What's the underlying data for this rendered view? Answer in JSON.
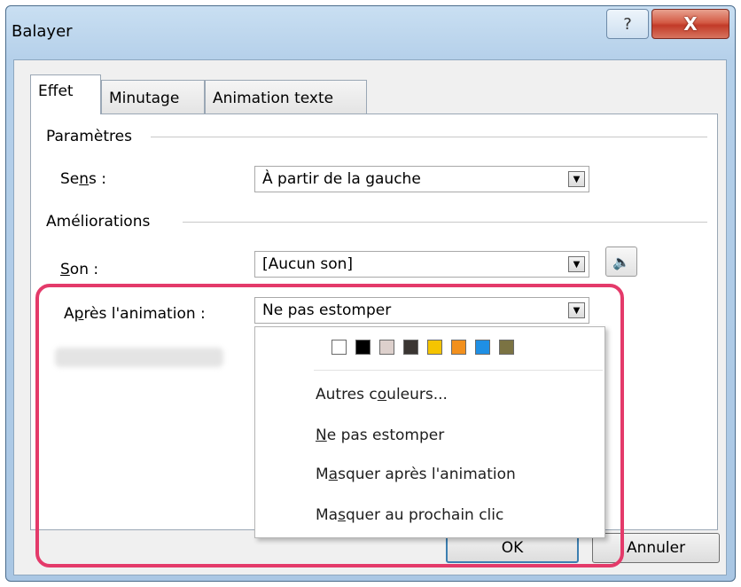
{
  "window": {
    "title": "Balayer",
    "help_glyph": "?",
    "close_glyph": "X"
  },
  "tabs": [
    {
      "label": "Effet",
      "active": true
    },
    {
      "label": "Minutage",
      "active": false
    },
    {
      "label": "Animation texte",
      "active": false
    }
  ],
  "parametres": {
    "group_label": "Paramètres",
    "sens_pre": "Se",
    "sens_key": "n",
    "sens_post": "s :",
    "sens_value": "À partir de la gauche"
  },
  "ameliorations": {
    "group_label": "Améliorations",
    "son_key": "S",
    "son_post": "on :",
    "son_value": "[Aucun son]",
    "apres_pre": "A",
    "apres_key": "p",
    "apres_post": "rès l'animation :",
    "apres_value": "Ne pas estomper"
  },
  "dropdown": {
    "swatch_colors": [
      "#ffffff",
      "#000000",
      "#ddd0cc",
      "#3a3532",
      "#f5c400",
      "#f2901d",
      "#1f8fe4",
      "#7b7343"
    ],
    "autres_pre": "Autres c",
    "autres_key": "o",
    "autres_post": "uleurs...",
    "ne_pas_key": "N",
    "ne_pas_post": "e pas estomper",
    "masquer_apres_pre": "M",
    "masquer_apres_key": "a",
    "masquer_apres_post": "squer après l'animation",
    "masquer_clic_pre": "Ma",
    "masquer_clic_key": "s",
    "masquer_clic_post": "quer au prochain clic"
  },
  "buttons": {
    "ok_label": "OK",
    "annuler_label": "Annuler"
  },
  "colors": {
    "highlight": "#e43a6a"
  }
}
